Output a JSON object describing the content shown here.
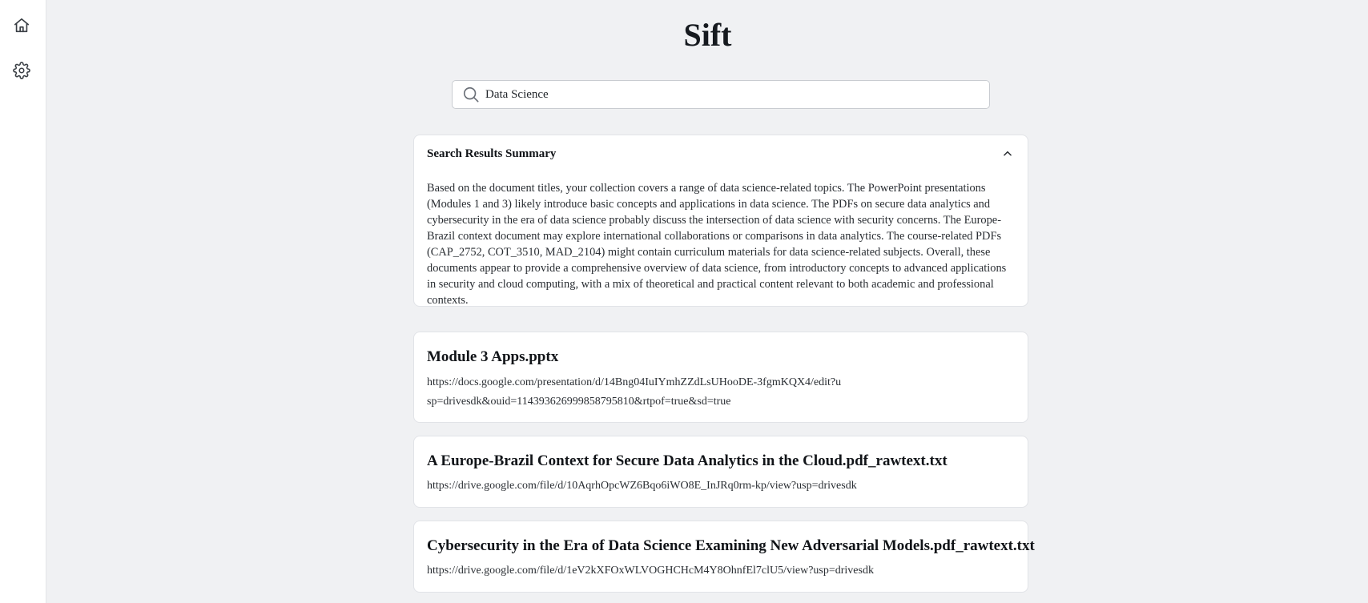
{
  "sidebar": {
    "items": [
      {
        "name": "home",
        "icon": "home-icon"
      },
      {
        "name": "settings",
        "icon": "gear-icon"
      }
    ]
  },
  "app": {
    "title": "Sift"
  },
  "search": {
    "value": "Data Science",
    "icon": "search-icon"
  },
  "summary": {
    "title": "Search Results Summary",
    "expanded": true,
    "toggle_icon": "chevron-up-icon",
    "body": "Based on the document titles, your collection covers a range of data science-related topics. The PowerPoint presentations (Modules 1 and 3) likely introduce basic concepts and applications in data science. The PDFs on secure data analytics and cybersecurity in the era of data science probably discuss the intersection of data science with security concerns. The Europe-Brazil context document may explore international collaborations or comparisons in data analytics. The course-related PDFs (CAP_2752, COT_3510, MAD_2104) might contain curriculum materials for data science-related subjects. Overall, these documents appear to provide a comprehensive overview of data science, from introductory concepts to advanced applications in security and cloud computing, with a mix of theoretical and practical content relevant to both academic and professional contexts."
  },
  "results": [
    {
      "title": "Module 3 Apps.pptx",
      "url": "https://docs.google.com/presentation/d/14Bng04IuIYmhZZdLsUHooDE-3fgmKQX4/edit?usp=drivesdk&ouid=114393626999858795810&rtpof=true&sd=true"
    },
    {
      "title": "A Europe-Brazil Context for Secure Data Analytics in the Cloud.pdf_rawtext.txt",
      "url": "https://drive.google.com/file/d/10AqrhOpcWZ6Bqo6iWO8E_InJRq0rm-kp/view?usp=drivesdk"
    },
    {
      "title": "Cybersecurity in the Era of Data Science Examining New Adversarial Models.pdf_rawtext.txt",
      "url": "https://drive.google.com/file/d/1eV2kXFOxWLVOGHCHcM4Y8OhnfEl7clU5/view?usp=drivesdk"
    }
  ],
  "colors": {
    "background": "#f0f1f3",
    "card": "#ffffff",
    "text": "#1f2328"
  }
}
